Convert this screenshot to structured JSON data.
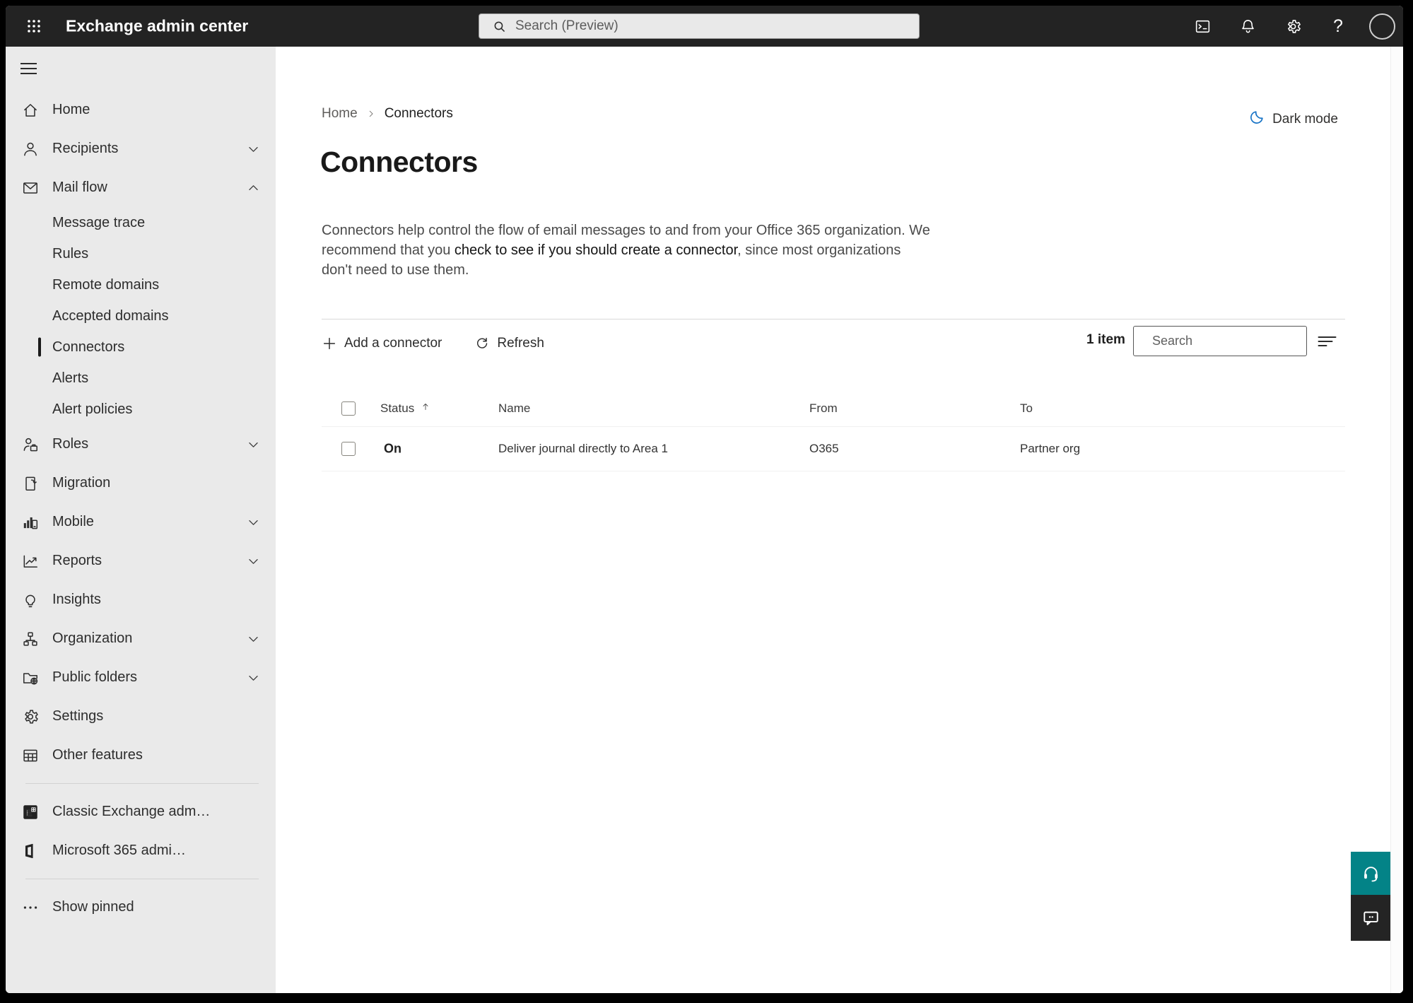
{
  "topbar": {
    "app_title": "Exchange admin center",
    "search_placeholder": "Search (Preview)",
    "help_glyph": "?",
    "icon_names": [
      "waffle-menu-icon",
      "terminal-icon",
      "bell-icon",
      "gear-icon",
      "help-icon",
      "avatar"
    ]
  },
  "sidebar": {
    "items": [
      {
        "label": "Home",
        "icon": "home-icon",
        "type": "top"
      },
      {
        "label": "Recipients",
        "icon": "person-icon",
        "type": "top",
        "chevron": "down"
      },
      {
        "label": "Mail flow",
        "icon": "mail-icon",
        "type": "top",
        "chevron": "up",
        "expanded": true
      },
      {
        "label": "Message trace",
        "type": "sub"
      },
      {
        "label": "Rules",
        "type": "sub"
      },
      {
        "label": "Remote domains",
        "type": "sub"
      },
      {
        "label": "Accepted domains",
        "type": "sub"
      },
      {
        "label": "Connectors",
        "type": "sub",
        "selected": true
      },
      {
        "label": "Alerts",
        "type": "sub"
      },
      {
        "label": "Alert policies",
        "type": "sub"
      },
      {
        "label": "Roles",
        "icon": "roles-icon",
        "type": "top",
        "chevron": "down"
      },
      {
        "label": "Migration",
        "icon": "migration-icon",
        "type": "top"
      },
      {
        "label": "Mobile",
        "icon": "mobile-icon",
        "type": "top",
        "chevron": "down"
      },
      {
        "label": "Reports",
        "icon": "reports-icon",
        "type": "top",
        "chevron": "down"
      },
      {
        "label": "Insights",
        "icon": "insights-icon",
        "type": "top"
      },
      {
        "label": "Organization",
        "icon": "organization-icon",
        "type": "top",
        "chevron": "down"
      },
      {
        "label": "Public folders",
        "icon": "public-folders-icon",
        "type": "top",
        "chevron": "down"
      },
      {
        "label": "Settings",
        "icon": "settings-icon",
        "type": "top"
      },
      {
        "label": "Other features",
        "icon": "other-features-icon",
        "type": "top"
      },
      {
        "label": "Classic Exchange adm…",
        "icon": "exchange-logo-icon",
        "type": "footer"
      },
      {
        "label": "Microsoft 365 admi…",
        "icon": "microsoft365-logo-icon",
        "type": "footer"
      },
      {
        "label": "Show pinned",
        "icon": "ellipsis-icon",
        "type": "footer"
      }
    ]
  },
  "main": {
    "breadcrumb": {
      "home": "Home",
      "current": "Connectors"
    },
    "dark_mode_label": "Dark mode",
    "page_title": "Connectors",
    "description": {
      "part1": "Connectors help control the flow of email messages to and from your Office 365 organization. We recommend that you ",
      "emphasis": "check to see if you should create a connector",
      "part2": ", since most organizations don't need to use them."
    },
    "toolbar": {
      "add_label": "Add a connector",
      "refresh_label": "Refresh",
      "item_count": "1 item",
      "search_placeholder": "Search"
    },
    "table": {
      "headers": {
        "status": "Status",
        "name": "Name",
        "from": "From",
        "to": "To"
      },
      "sorted_by": "Status",
      "sort_direction": "ascending",
      "rows": [
        {
          "status": "On",
          "name": "Deliver journal directly to Area 1",
          "from": "O365",
          "to": "Partner org"
        }
      ]
    }
  },
  "floating": {
    "icon_names": [
      "headset-icon",
      "chat-icon"
    ]
  },
  "colors": {
    "topbar": "#232323",
    "sidebar": "#eaeaea",
    "teal_button": "#038387",
    "chat_button": "#242424",
    "moon_blue": "#1773c6"
  }
}
